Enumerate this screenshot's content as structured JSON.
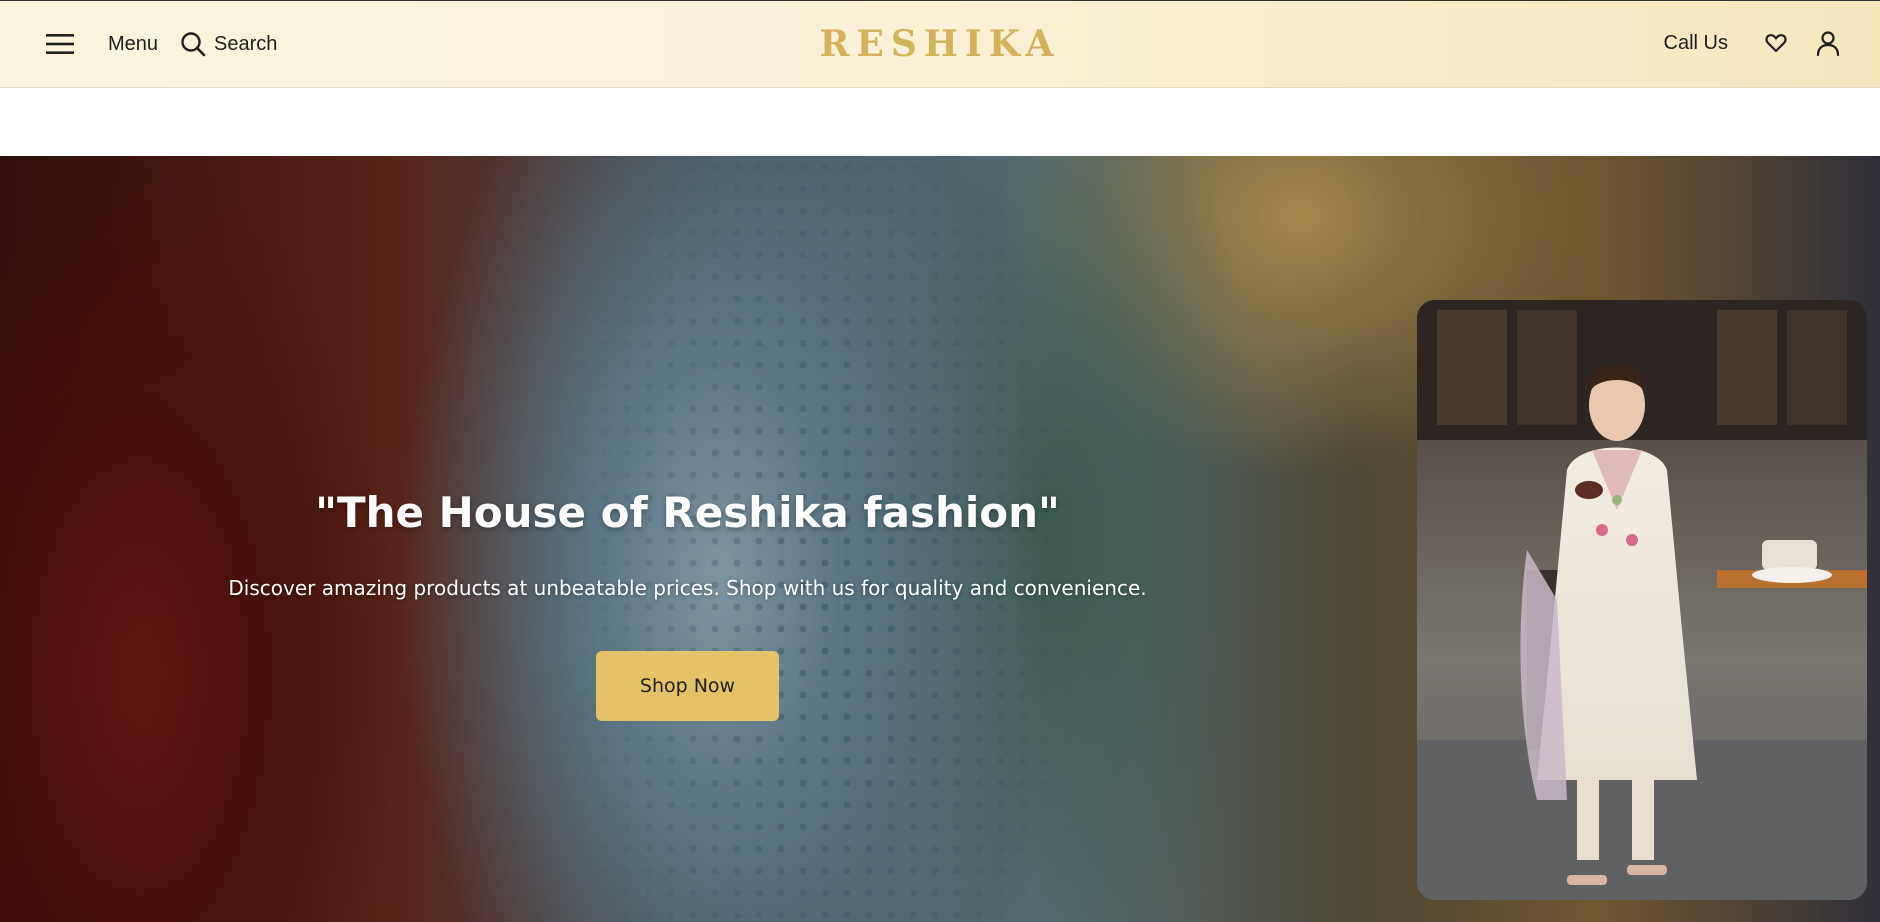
{
  "header": {
    "menu_label": "Menu",
    "search_label": "Search",
    "logo_text": "RESHIKA",
    "call_us_label": "Call Us"
  },
  "hero": {
    "title": "\"The House of Reshika fashion\"",
    "subtitle": "Discover amazing products at unbeatable prices. Shop with us for quality and convenience.",
    "cta_label": "Shop Now"
  },
  "colors": {
    "header_bg": "#faf1d6",
    "logo_gold": "#d3b45c",
    "cta_gold": "#e3c268",
    "text_dark": "#1f1f1f"
  },
  "icons": [
    "hamburger-icon",
    "search-icon",
    "heart-icon",
    "user-icon"
  ]
}
